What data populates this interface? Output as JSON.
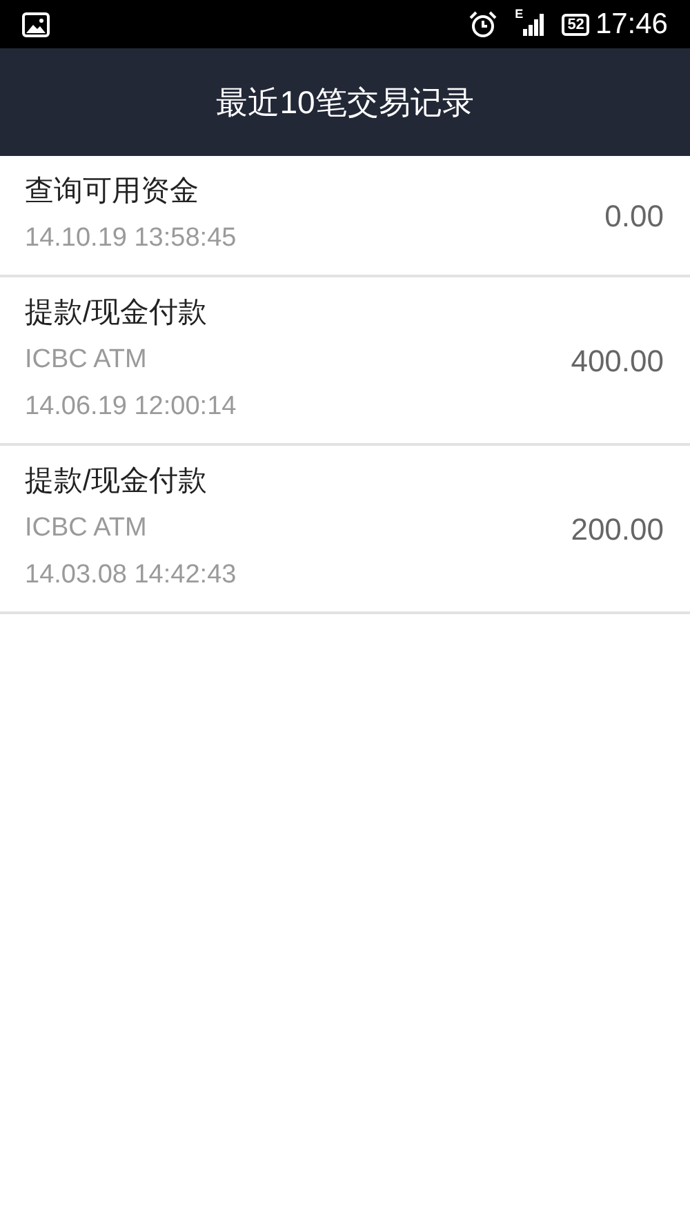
{
  "status_bar": {
    "network": "E",
    "battery": "52",
    "time": "17:46"
  },
  "header": {
    "title": "最近10笔交易记录"
  },
  "transactions": [
    {
      "title": "查询可用资金",
      "datetime": "14.10.19 13:58:45",
      "amount": "0.00"
    },
    {
      "title": "提款/现金付款",
      "merchant": "ICBC ATM",
      "datetime": "14.06.19 12:00:14",
      "amount": "400.00"
    },
    {
      "title": "提款/现金付款",
      "merchant": "ICBC ATM",
      "datetime": "14.03.08 14:42:43",
      "amount": "200.00"
    }
  ]
}
